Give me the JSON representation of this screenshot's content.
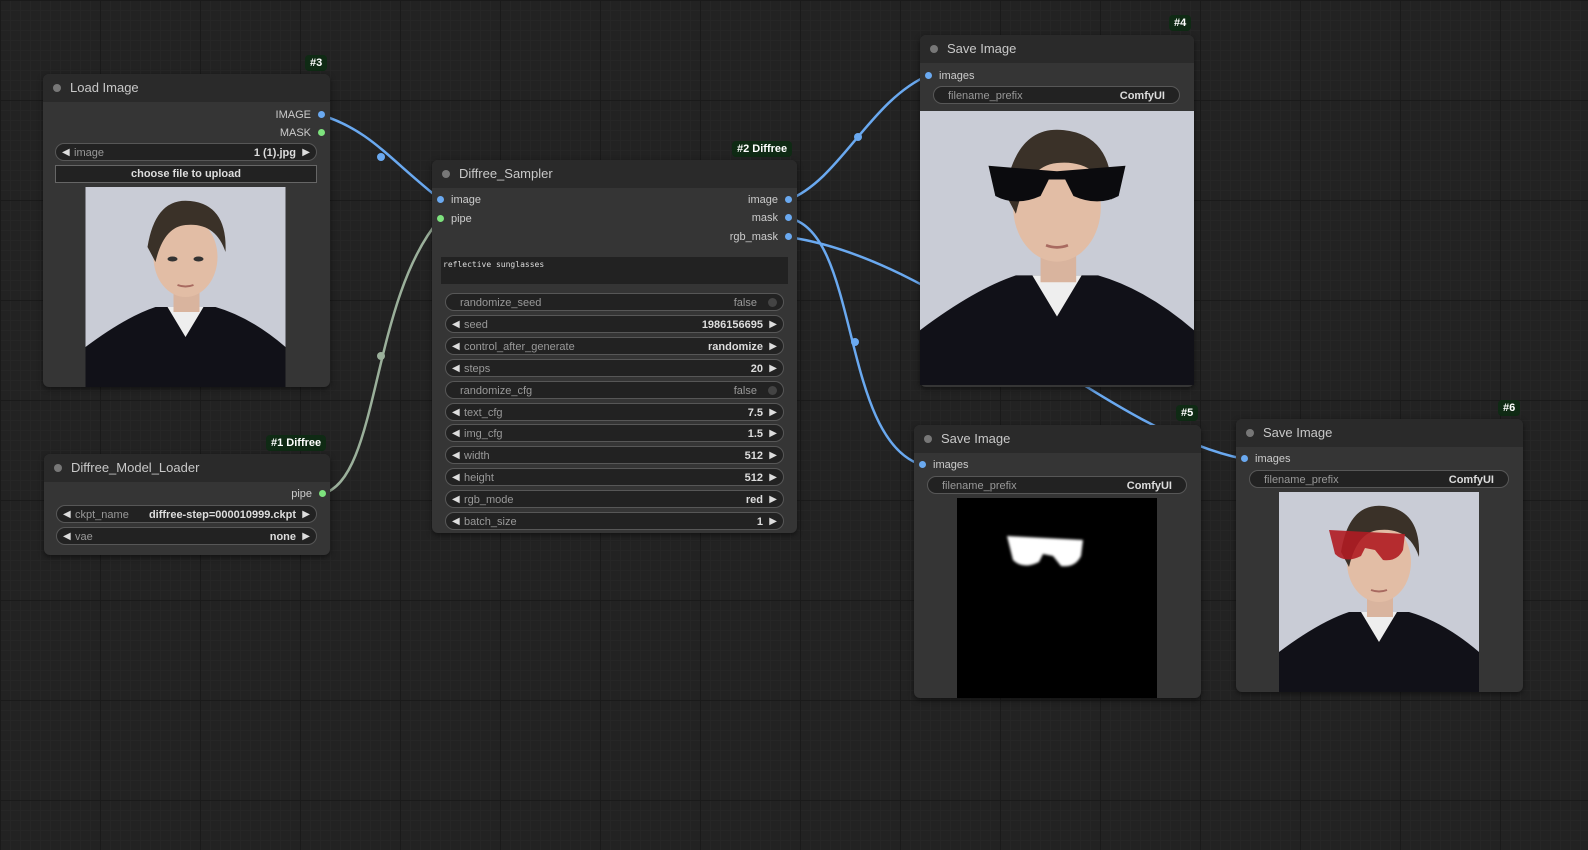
{
  "nodes": {
    "load_image": {
      "badge": "#3",
      "title": "Load Image",
      "outputs": [
        "IMAGE",
        "MASK"
      ],
      "widget_image": {
        "label": "image",
        "value": "1 (1).jpg"
      },
      "upload_label": "choose file to upload"
    },
    "model_loader": {
      "badge": "#1 Diffree",
      "title": "Diffree_Model_Loader",
      "output": "pipe",
      "ckpt": {
        "label": "ckpt_name",
        "value": "diffree-step=000010999.ckpt"
      },
      "vae": {
        "label": "vae",
        "value": "none"
      }
    },
    "sampler": {
      "badge": "#2 Diffree",
      "title": "Diffree_Sampler",
      "inputs": [
        "image",
        "pipe"
      ],
      "outputs": [
        "image",
        "mask",
        "rgb_mask"
      ],
      "prompt": "reflective sunglasses",
      "widgets": [
        {
          "label": "randomize_seed",
          "value": "false",
          "kind": "toggle"
        },
        {
          "label": "seed",
          "value": "1986156695",
          "kind": "number"
        },
        {
          "label": "control_after_generate",
          "value": "randomize",
          "kind": "combo"
        },
        {
          "label": "steps",
          "value": "20",
          "kind": "number"
        },
        {
          "label": "randomize_cfg",
          "value": "false",
          "kind": "toggle"
        },
        {
          "label": "text_cfg",
          "value": "7.5",
          "kind": "number"
        },
        {
          "label": "img_cfg",
          "value": "1.5",
          "kind": "number"
        },
        {
          "label": "width",
          "value": "512",
          "kind": "number"
        },
        {
          "label": "height",
          "value": "512",
          "kind": "number"
        },
        {
          "label": "rgb_mode",
          "value": "red",
          "kind": "combo"
        },
        {
          "label": "batch_size",
          "value": "1",
          "kind": "number"
        }
      ]
    },
    "save4": {
      "badge": "#4",
      "title": "Save Image",
      "input": "images",
      "prefix_label": "filename_prefix",
      "prefix_value": "ComfyUI"
    },
    "save5": {
      "badge": "#5",
      "title": "Save Image",
      "input": "images",
      "prefix_label": "filename_prefix",
      "prefix_value": "ComfyUI"
    },
    "save6": {
      "badge": "#6",
      "title": "Save Image",
      "input": "images",
      "prefix_label": "filename_prefix",
      "prefix_value": "ComfyUI"
    }
  },
  "colors": {
    "image_link": "#6aa9f0",
    "pipe_link": "#9bb09b",
    "background": "#222222",
    "node": "#353535",
    "badge": "#0f2a14",
    "rgb_mask_overlay": "#b01c22"
  }
}
